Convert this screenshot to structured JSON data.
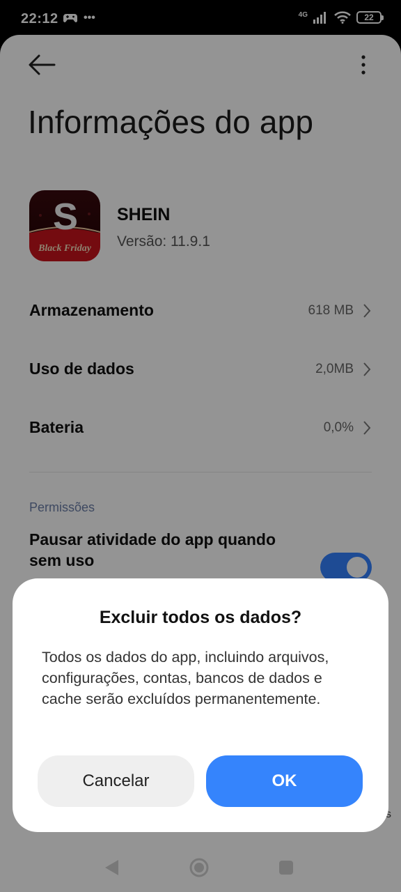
{
  "status_bar": {
    "time": "22:12",
    "more": "•••",
    "network": "4G",
    "battery": "22"
  },
  "header": {
    "title": "Informações do app"
  },
  "app": {
    "name": "SHEIN",
    "version": "Versão: 11.9.1",
    "icon_letter": "S",
    "icon_text": "Black Friday"
  },
  "rows": [
    {
      "label": "Armazenamento",
      "value": "618 MB"
    },
    {
      "label": "Uso de dados",
      "value": "2,0MB"
    },
    {
      "label": "Bateria",
      "value": "0,0%"
    }
  ],
  "permissions": {
    "section_label": "Permissões",
    "pause_title": "Pausar atividade do app quando sem uso",
    "pause_enabled": true,
    "peek_text": "os"
  },
  "dialog": {
    "title": "Excluir todos os dados?",
    "message": "Todos os dados do app, incluindo arquivos, configurações, contas, bancos de dados e cache serão excluídos permanentemente.",
    "cancel_label": "Cancelar",
    "ok_label": "OK"
  },
  "colors": {
    "accent": "#3584fc",
    "toggle_on": "#3482ff",
    "section_header": "#6b7ea8"
  }
}
